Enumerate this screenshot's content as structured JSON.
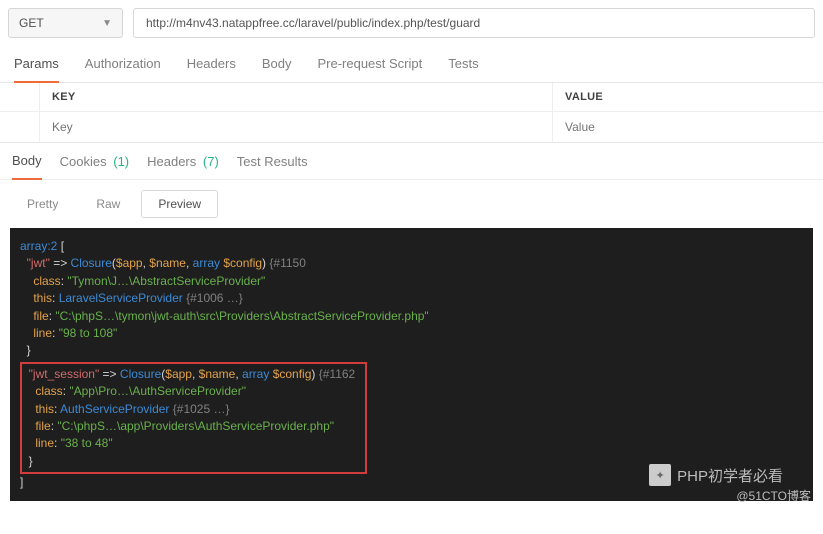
{
  "request": {
    "method": "GET",
    "url": "http://m4nv43.natappfree.cc/laravel/public/index.php/test/guard"
  },
  "tabs1": {
    "items": [
      "Params",
      "Authorization",
      "Headers",
      "Body",
      "Pre-request Script",
      "Tests"
    ],
    "active": "Params"
  },
  "paramsTable": {
    "headers": {
      "key": "KEY",
      "value": "VALUE"
    },
    "placeholders": {
      "key": "Key",
      "value": "Value"
    }
  },
  "tabs2": {
    "items": [
      {
        "label": "Body",
        "count": null
      },
      {
        "label": "Cookies",
        "count": "(1)"
      },
      {
        "label": "Headers",
        "count": "(7)"
      },
      {
        "label": "Test Results",
        "count": null
      }
    ],
    "active": "Body"
  },
  "viewModes": {
    "items": [
      "Pretty",
      "Raw",
      "Preview"
    ],
    "active": "Preview"
  },
  "code": {
    "l1a": "array:2",
    "l1b": " [",
    "jwt_key": "\"jwt\"",
    "arrow": " => ",
    "closure": "Closure",
    "sig": "(",
    "arg_app": "$app",
    "arg_name": "$name",
    "arg_array": "array ",
    "arg_config": "$config",
    "sig_close": ")",
    "hash1": " {#1150",
    "class_lbl": "class",
    "colon": ": ",
    "jwt_class": "\"Tymon\\J…\\AbstractServiceProvider\"",
    "this_lbl": "this",
    "jwt_this": "LaravelServiceProvider",
    "jwt_this_hash": " {#1006 …}",
    "file_lbl": "file",
    "jwt_file": "\"C:\\phpS…\\tymon\\jwt-auth\\src\\Providers\\AbstractServiceProvider.php\"",
    "line_lbl": "line",
    "jwt_line": "\"98 to 108\"",
    "brace_close": "}",
    "jwts_key": "\"jwt_session\"",
    "hash2": " {#1162",
    "jwts_class": "\"App\\Pro…\\AuthServiceProvider\"",
    "jwts_this": "AuthServiceProvider",
    "jwts_this_hash": " {#1025 …}",
    "jwts_file": "\"C:\\phpS…\\app\\Providers\\AuthServiceProvider.php\"",
    "jwts_line": "\"38 to 48\"",
    "close_bracket": "]"
  },
  "watermark1": "PHP初学者必看",
  "watermark2": "@51CTO博客"
}
